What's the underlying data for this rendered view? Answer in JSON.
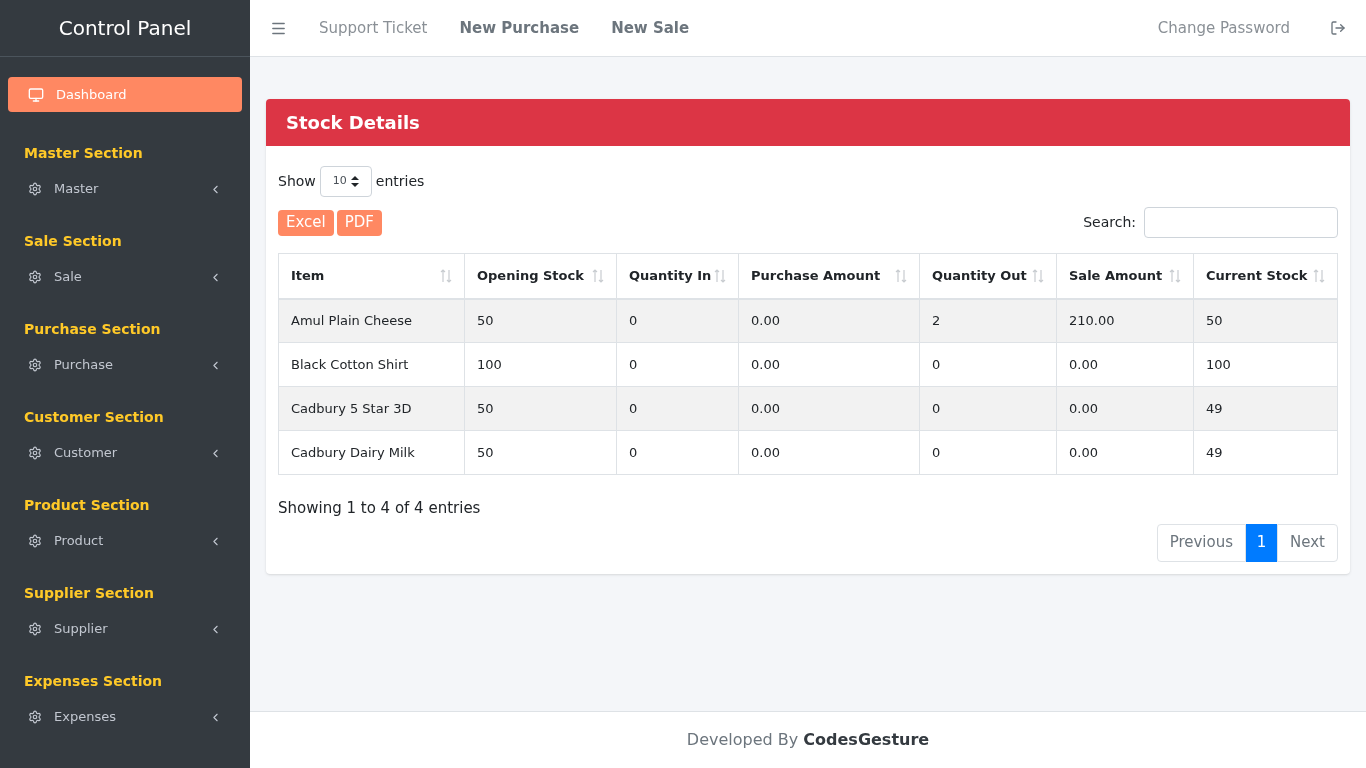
{
  "sidebar": {
    "title": "Control Panel",
    "dashboard": {
      "label": "Dashboard",
      "selected": true
    },
    "sections": [
      {
        "heading": "Master Section",
        "item": {
          "label": "Master",
          "expanded": false
        }
      },
      {
        "heading": "Sale Section",
        "item": {
          "label": "Sale",
          "expanded": false
        }
      },
      {
        "heading": "Purchase Section",
        "item": {
          "label": "Purchase",
          "expanded": false
        }
      },
      {
        "heading": "Customer Section",
        "item": {
          "label": "Customer",
          "expanded": false
        }
      },
      {
        "heading": "Product Section",
        "item": {
          "label": "Product",
          "expanded": false
        }
      },
      {
        "heading": "Supplier Section",
        "item": {
          "label": "Supplier",
          "expanded": false
        }
      },
      {
        "heading": "Expenses Section",
        "item": {
          "label": "Expenses",
          "expanded": false
        }
      }
    ]
  },
  "navbar": {
    "links": [
      {
        "label": "Support Ticket",
        "bold": false
      },
      {
        "label": "New Purchase",
        "bold": true
      },
      {
        "label": "New Sale",
        "bold": true
      }
    ],
    "right_link": "Change Password"
  },
  "card": {
    "title": "Stock Details",
    "show_label": "Show",
    "page_size": "10",
    "entries_label": "entries",
    "buttons": [
      "Excel",
      "PDF"
    ],
    "search_label": "Search:",
    "table": {
      "columns": [
        "Item",
        "Opening Stock",
        "Quantity In",
        "Purchase Amount",
        "Quantity Out",
        "Sale Amount",
        "Current Stock"
      ],
      "rows": [
        [
          "Amul Plain Cheese",
          "50",
          "0",
          "0.00",
          "2",
          "210.00",
          "50"
        ],
        [
          "Black Cotton Shirt",
          "100",
          "0",
          "0.00",
          "0",
          "0.00",
          "100"
        ],
        [
          "Cadbury 5 Star 3D",
          "50",
          "0",
          "0.00",
          "0",
          "0.00",
          "49"
        ],
        [
          "Cadbury Dairy Milk",
          "50",
          "0",
          "0.00",
          "0",
          "0.00",
          "49"
        ]
      ]
    },
    "info": "Showing 1 to 4 of 4 entries",
    "pagination": {
      "previous": "Previous",
      "pages": [
        {
          "label": "1",
          "selected": true
        }
      ],
      "next": "Next"
    }
  },
  "footer": {
    "prefix": "Developed By",
    "brand": "CodesGesture"
  }
}
